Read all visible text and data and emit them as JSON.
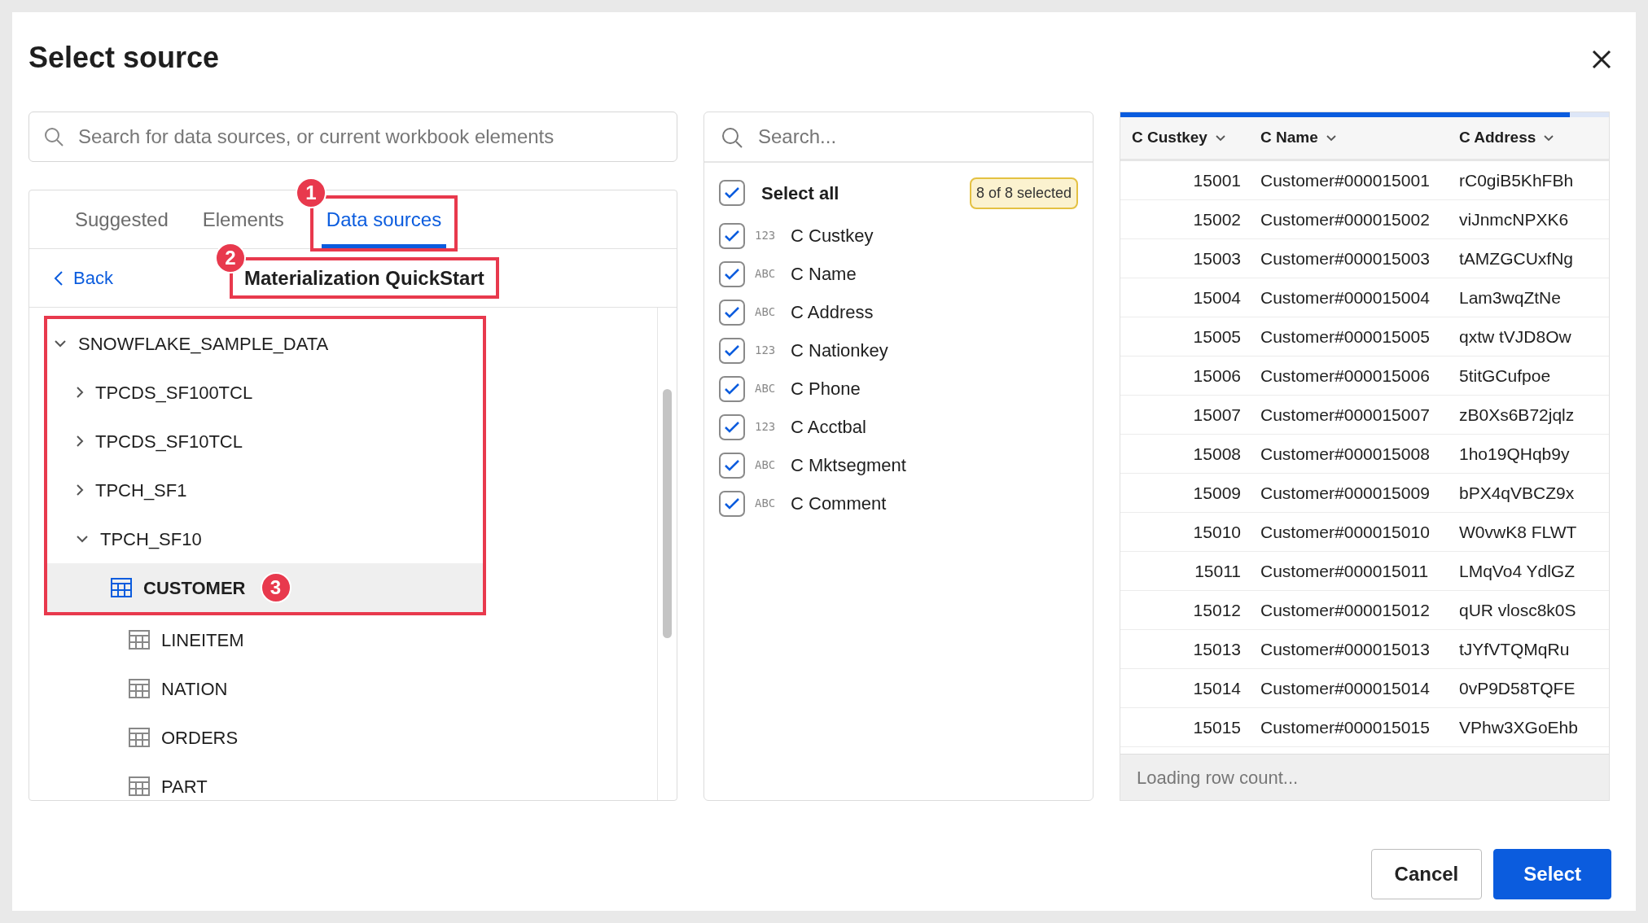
{
  "dialog": {
    "title": "Select source"
  },
  "search": {
    "placeholder": "Search for data sources, or current workbook elements"
  },
  "tabs": [
    {
      "label": "Suggested",
      "selected": false
    },
    {
      "label": "Elements",
      "selected": false
    },
    {
      "label": "Data sources",
      "selected": true,
      "annotation": "1"
    }
  ],
  "breadcrumb": {
    "back": "Back",
    "title": "Materialization QuickStart",
    "annotation": "2"
  },
  "tree": [
    {
      "label": "SNOWFLAKE_SAMPLE_DATA",
      "kind": "folder",
      "expanded": true,
      "children": [
        {
          "label": "TPCDS_SF100TCL",
          "kind": "folder",
          "expanded": false
        },
        {
          "label": "TPCDS_SF10TCL",
          "kind": "folder",
          "expanded": false
        },
        {
          "label": "TPCH_SF1",
          "kind": "folder",
          "expanded": false
        },
        {
          "label": "TPCH_SF10",
          "kind": "folder",
          "expanded": true,
          "children": [
            {
              "label": "CUSTOMER",
              "kind": "table",
              "selected": true,
              "annotation": "3"
            },
            {
              "label": "LINEITEM",
              "kind": "table",
              "selected": false
            },
            {
              "label": "NATION",
              "kind": "table",
              "selected": false
            },
            {
              "label": "ORDERS",
              "kind": "table",
              "selected": false
            },
            {
              "label": "PART",
              "kind": "table",
              "selected": false
            }
          ]
        }
      ]
    }
  ],
  "columns_panel": {
    "placeholder": "Search...",
    "select_all": {
      "label": "Select all",
      "checked": true
    },
    "count": "8 of 8 selected",
    "columns": [
      {
        "type_label": "123",
        "name": "C Custkey",
        "checked": true
      },
      {
        "type_label": "ABC",
        "name": "C Name",
        "checked": true
      },
      {
        "type_label": "ABC",
        "name": "C Address",
        "checked": true
      },
      {
        "type_label": "123",
        "name": "C Nationkey",
        "checked": true
      },
      {
        "type_label": "ABC",
        "name": "C Phone",
        "checked": true
      },
      {
        "type_label": "123",
        "name": "C Acctbal",
        "checked": true
      },
      {
        "type_label": "ABC",
        "name": "C Mktsegment",
        "checked": true
      },
      {
        "type_label": "ABC",
        "name": "C Comment",
        "checked": true
      }
    ]
  },
  "preview": {
    "loading": {
      "level": 0.92
    },
    "columns": [
      "C Custkey",
      "C Name",
      "C Address"
    ],
    "rows": [
      [
        "15001",
        "Customer#000015001",
        "rC0giB5KhFBh"
      ],
      [
        "15002",
        "Customer#000015002",
        "viJnmcNPXK6"
      ],
      [
        "15003",
        "Customer#000015003",
        "tAMZGCUxfNg"
      ],
      [
        "15004",
        "Customer#000015004",
        "Lam3wqZtNe"
      ],
      [
        "15005",
        "Customer#000015005",
        "qxtw tVJD8Ow"
      ],
      [
        "15006",
        "Customer#000015006",
        "5titGCufpoe"
      ],
      [
        "15007",
        "Customer#000015007",
        "zB0Xs6B72jqlz"
      ],
      [
        "15008",
        "Customer#000015008",
        "1ho19QHqb9y"
      ],
      [
        "15009",
        "Customer#000015009",
        "bPX4qVBCZ9x"
      ],
      [
        "15010",
        "Customer#000015010",
        "W0vwK8 FLWT"
      ],
      [
        "15011",
        "Customer#000015011",
        "LMqVo4 YdlGZ"
      ],
      [
        "15012",
        "Customer#000015012",
        "qUR vlosc8k0S"
      ],
      [
        "15013",
        "Customer#000015013",
        "tJYfVTQMqRu"
      ],
      [
        "15014",
        "Customer#000015014",
        "0vP9D58TQFE"
      ],
      [
        "15015",
        "Customer#000015015",
        "VPhw3XGoEhb"
      ]
    ],
    "footer": "Loading row count..."
  },
  "buttons": [
    {
      "label": "Cancel",
      "kind": "secondary"
    },
    {
      "label": "Select",
      "kind": "primary"
    }
  ]
}
